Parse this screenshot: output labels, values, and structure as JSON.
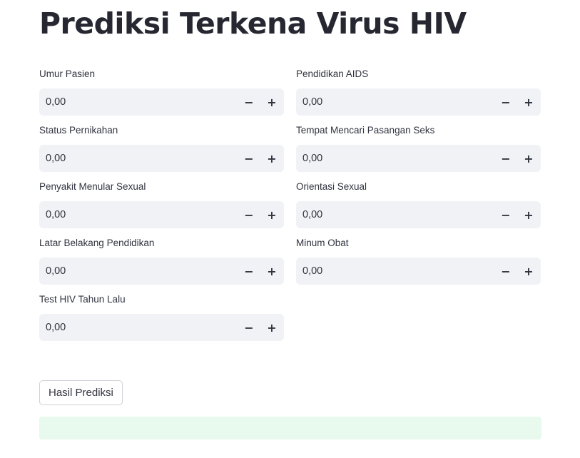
{
  "page": {
    "title": "Prediksi Terkena Virus HIV"
  },
  "fields": [
    {
      "label": "Umur Pasien",
      "value": "0,00"
    },
    {
      "label": "Pendidikan AIDS",
      "value": "0,00"
    },
    {
      "label": "Status Pernikahan",
      "value": "0,00"
    },
    {
      "label": "Tempat Mencari Pasangan Seks",
      "value": "0,00"
    },
    {
      "label": "Penyakit Menular Sexual",
      "value": "0,00"
    },
    {
      "label": "Orientasi Sexual",
      "value": "0,00"
    },
    {
      "label": "Latar Belakang Pendidikan",
      "value": "0,00"
    },
    {
      "label": "Minum Obat",
      "value": "0,00"
    },
    {
      "label": "Test HIV Tahun Lalu",
      "value": "0,00"
    }
  ],
  "stepper": {
    "minus_symbol": "−",
    "plus_symbol": "+"
  },
  "actions": {
    "predict_label": "Hasil Prediksi"
  },
  "result": {
    "text": ""
  },
  "colors": {
    "input_background": "#f0f2f6",
    "result_background": "#e8f9ee",
    "text": "#31333f"
  }
}
